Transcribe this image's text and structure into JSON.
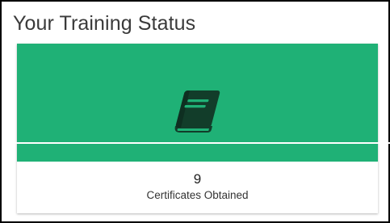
{
  "page": {
    "title": "Your Training Status"
  },
  "card": {
    "icon": "book-icon",
    "accent_color": "#1fb176",
    "icon_color": "#123d2a",
    "count": "9",
    "label": "Certificates Obtained"
  }
}
